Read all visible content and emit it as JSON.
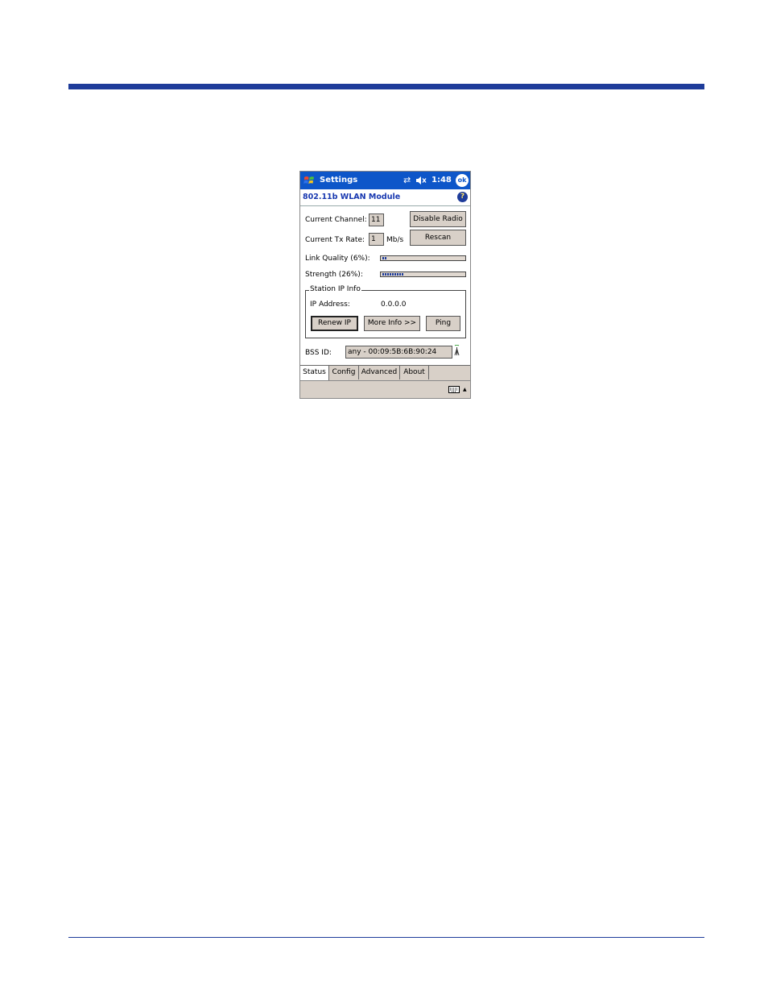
{
  "titlebar": {
    "title": "Settings",
    "clock": "1:48",
    "ok_label": "ok"
  },
  "subheader": {
    "title": "802.11b WLAN Module",
    "help_label": "?"
  },
  "status": {
    "channel_label": "Current Channel:",
    "channel_value": "11",
    "txrate_label": "Current Tx Rate:",
    "txrate_value": "1",
    "txrate_unit": "Mb/s",
    "disable_radio_label": "Disable Radio",
    "rescan_label": "Rescan",
    "link_quality_label": "Link Quality (6%):",
    "link_quality_fraction": 0.06,
    "strength_label": "Strength (26%):",
    "strength_fraction": 0.26
  },
  "station": {
    "legend": "Station IP Info",
    "ip_label": "IP Address:",
    "ip_value": "0.0.0.0",
    "renew_label": "Renew IP",
    "more_info_label": "More Info >>",
    "ping_label": "Ping"
  },
  "bss": {
    "label": "BSS ID:",
    "value": "any - 00:09:5B:6B:90:24"
  },
  "tabs": [
    {
      "label": "Status",
      "active": true
    },
    {
      "label": "Config",
      "active": false
    },
    {
      "label": "Advanced",
      "active": false
    },
    {
      "label": "About",
      "active": false
    }
  ],
  "colors": {
    "titlebar": "#0d56c9",
    "accent": "#1838b0",
    "rule": "#1e3c9a",
    "control_bg": "#d8d0c8"
  },
  "icons": [
    "windows-start-icon",
    "connectivity-icon",
    "volume-mute-icon",
    "help-icon",
    "antenna-icon",
    "keyboard-icon",
    "arrow-up-icon"
  ]
}
